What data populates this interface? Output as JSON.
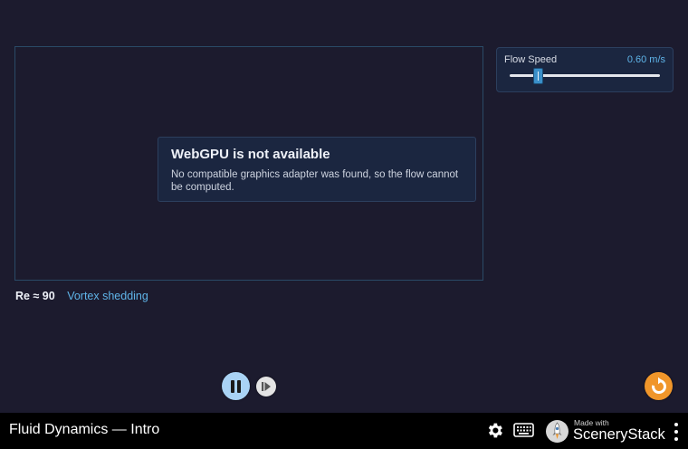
{
  "canvas": {
    "error_title": "WebGPU is not available",
    "error_message": "No compatible graphics adapter was found, so the flow cannot be computed."
  },
  "flow_speed": {
    "label": "Flow Speed",
    "value_text": "0.60 m/s",
    "slider_fraction": 0.19
  },
  "readout": {
    "reynolds": "Re ≈ 90",
    "regime": "Vortex shedding"
  },
  "controls": {
    "play_pause_icon": "pause-icon",
    "step_icon": "step-forward-icon",
    "reset_icon": "reset-icon"
  },
  "nav": {
    "title": "Fluid Dynamics — Intro",
    "brand_small": "Made with",
    "brand_name": "SceneryStack"
  },
  "colors": {
    "background": "#1c1b2e",
    "accent": "#5fb4e8",
    "reset": "#f0962a",
    "play": "#a9d3f5"
  }
}
